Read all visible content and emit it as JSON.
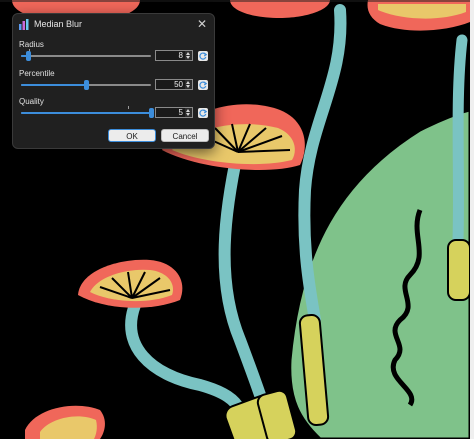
{
  "dialog": {
    "title": "Median Blur",
    "icon": "effects-bar-chart-icon",
    "close_icon": "close-icon",
    "params": [
      {
        "label": "Radius",
        "value": "8",
        "fraction": 0.05
      },
      {
        "label": "Percentile",
        "value": "50",
        "fraction": 0.5
      },
      {
        "label": "Quality",
        "value": "5",
        "fraction": 1.0
      }
    ],
    "ok_label": "OK",
    "cancel_label": "Cancel",
    "reset_icon": "reset-icon"
  },
  "colors": {
    "accent": "#3c8ddb",
    "dialog_bg": "#202020",
    "canvas_bg": "#000000",
    "mushroom_cap": "#f0675a",
    "mushroom_gill": "#e9c86a",
    "stem_teal": "#7ac3c3",
    "stem_yellow": "#d6d25c",
    "leaf_green": "#7fc28a"
  }
}
